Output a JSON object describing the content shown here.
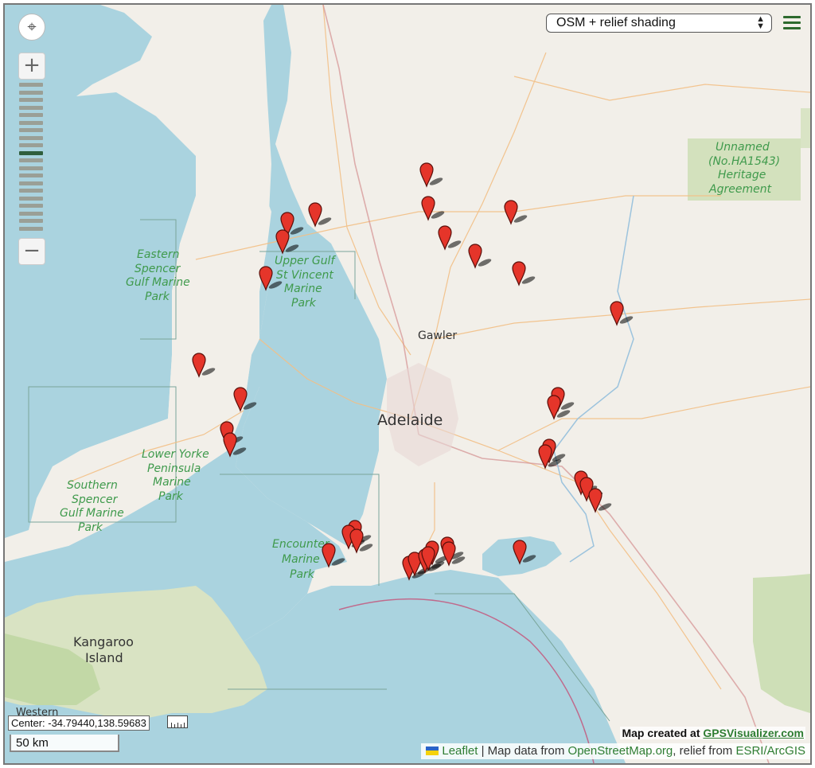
{
  "map": {
    "layer_select": {
      "selected": "OSM + relief shading"
    },
    "menu_icon": "hamburger-menu-icon",
    "locate_icon": "locate-crosshair-icon",
    "zoom": {
      "in_label": "+",
      "out_label": "−",
      "levels": 20,
      "active_level": 11
    },
    "center_readout": "Center: -34.79440,138.59683",
    "scale_label": "50 km",
    "credit": {
      "prefix": "Map created at ",
      "link": "GPSVisualizer.com"
    },
    "attribution": {
      "leaflet": "Leaflet",
      "sep": " | Map data from ",
      "osm": "OpenStreetMap.org",
      "relief_prefix": ", relief from ",
      "esri": "ESRI/ArcGIS"
    },
    "colors": {
      "water": "#aad3df",
      "land": "#f2efe9",
      "park": "#c8dcae",
      "marker": "#e5352a",
      "road": "#f4c48a"
    },
    "labels": {
      "adelaide": "Adelaide",
      "gawler": "Gawler",
      "kangaroo_1": "Kangaroo",
      "kangaroo_2": "Island",
      "espg_1": "Eastern",
      "espg_2": "Spencer",
      "espg_3": "Gulf Marine",
      "espg_4": "Park",
      "ugsv_1": "Upper Gulf",
      "ugsv_2": "St Vincent",
      "ugsv_3": "Marine",
      "ugsv_4": "Park",
      "lyp_1": "Lower Yorke",
      "lyp_2": "Peninsula",
      "lyp_3": "Marine",
      "lyp_4": "Park",
      "sspg_1": "Southern",
      "sspg_2": "Spencer",
      "sspg_3": "Gulf Marine",
      "sspg_4": "Park",
      "emp_1": "Encounter",
      "emp_2": "Marine",
      "emp_3": "Park",
      "her_1": "Unnamed",
      "her_2": "(No.HA1543)",
      "her_3": "Heritage",
      "her_4": "Agreement",
      "western": "Western"
    }
  }
}
